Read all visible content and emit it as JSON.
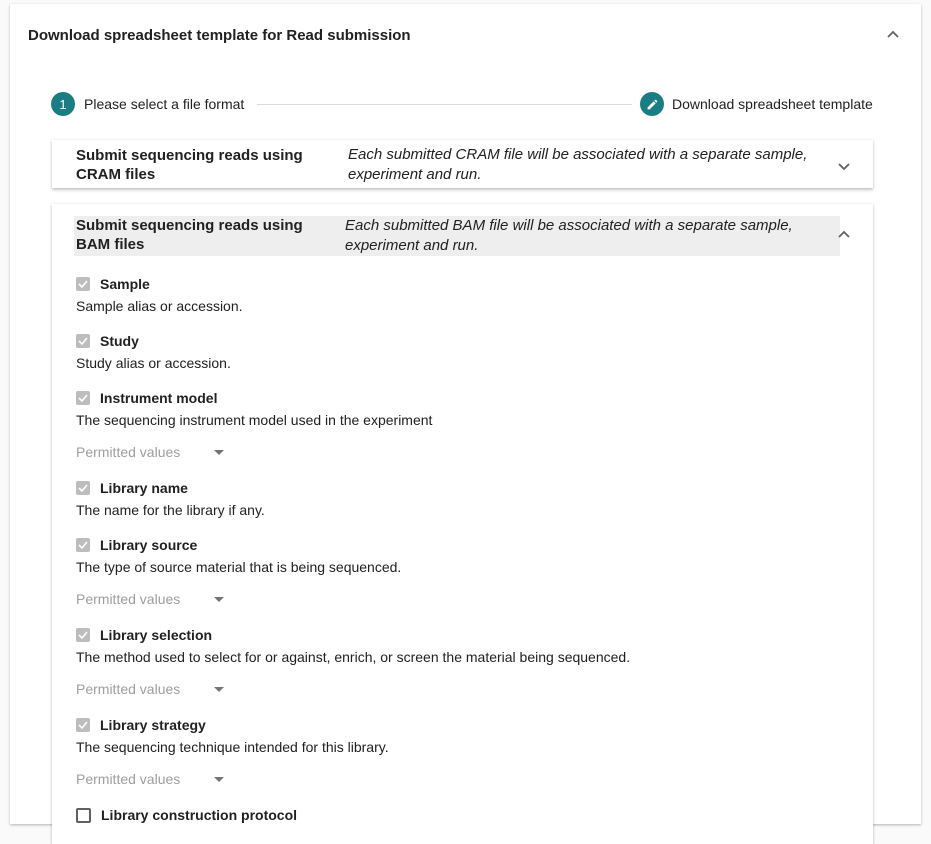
{
  "card": {
    "title": "Download spreadsheet template for Read submission"
  },
  "stepper": {
    "step1_number": "1",
    "step1_label": "Please select a file format",
    "step2_label": "Download spreadsheet template"
  },
  "panels": {
    "cram": {
      "title_line1": "Submit sequencing reads using",
      "title_line2": "CRAM files",
      "desc_line1": "Each submitted CRAM file will be associated with a separate sample,",
      "desc_line2": "experiment and run."
    },
    "bam": {
      "title_line1": "Submit sequencing reads using",
      "title_line2": "BAM files",
      "desc_line1": "Each submitted BAM file will be associated with a separate sample,",
      "desc_line2": "experiment and run."
    }
  },
  "fields": [
    {
      "name": "Sample",
      "desc": "Sample alias or accession.",
      "checked": true
    },
    {
      "name": "Study",
      "desc": "Study alias or accession.",
      "checked": true
    },
    {
      "name": "Instrument model",
      "desc": "The sequencing instrument model used in the experiment",
      "checked": true,
      "select": "Permitted values"
    },
    {
      "name": "Library name",
      "desc": "The name for the library if any.",
      "checked": true
    },
    {
      "name": "Library source",
      "desc": "The type of source material that is being sequenced.",
      "checked": true,
      "select": "Permitted values"
    },
    {
      "name": "Library selection",
      "desc": "The method used to select for or against, enrich, or screen the material being sequenced.",
      "checked": true,
      "select": "Permitted values"
    },
    {
      "name": "Library strategy",
      "desc": "The sequencing technique intended for this library.",
      "checked": true,
      "select": "Permitted values"
    },
    {
      "name": "Library construction protocol",
      "desc": "",
      "checked": false
    }
  ],
  "colors": {
    "accent": "#1a7d83",
    "checkbox_disabled": "#bdbdbd",
    "placeholder": "#9e9e9e"
  },
  "icons": {
    "card_toggle": "chevron-up-icon",
    "cram_toggle": "chevron-down-icon",
    "bam_toggle": "chevron-up-icon",
    "step2": "pencil-icon",
    "check": "check-icon"
  }
}
